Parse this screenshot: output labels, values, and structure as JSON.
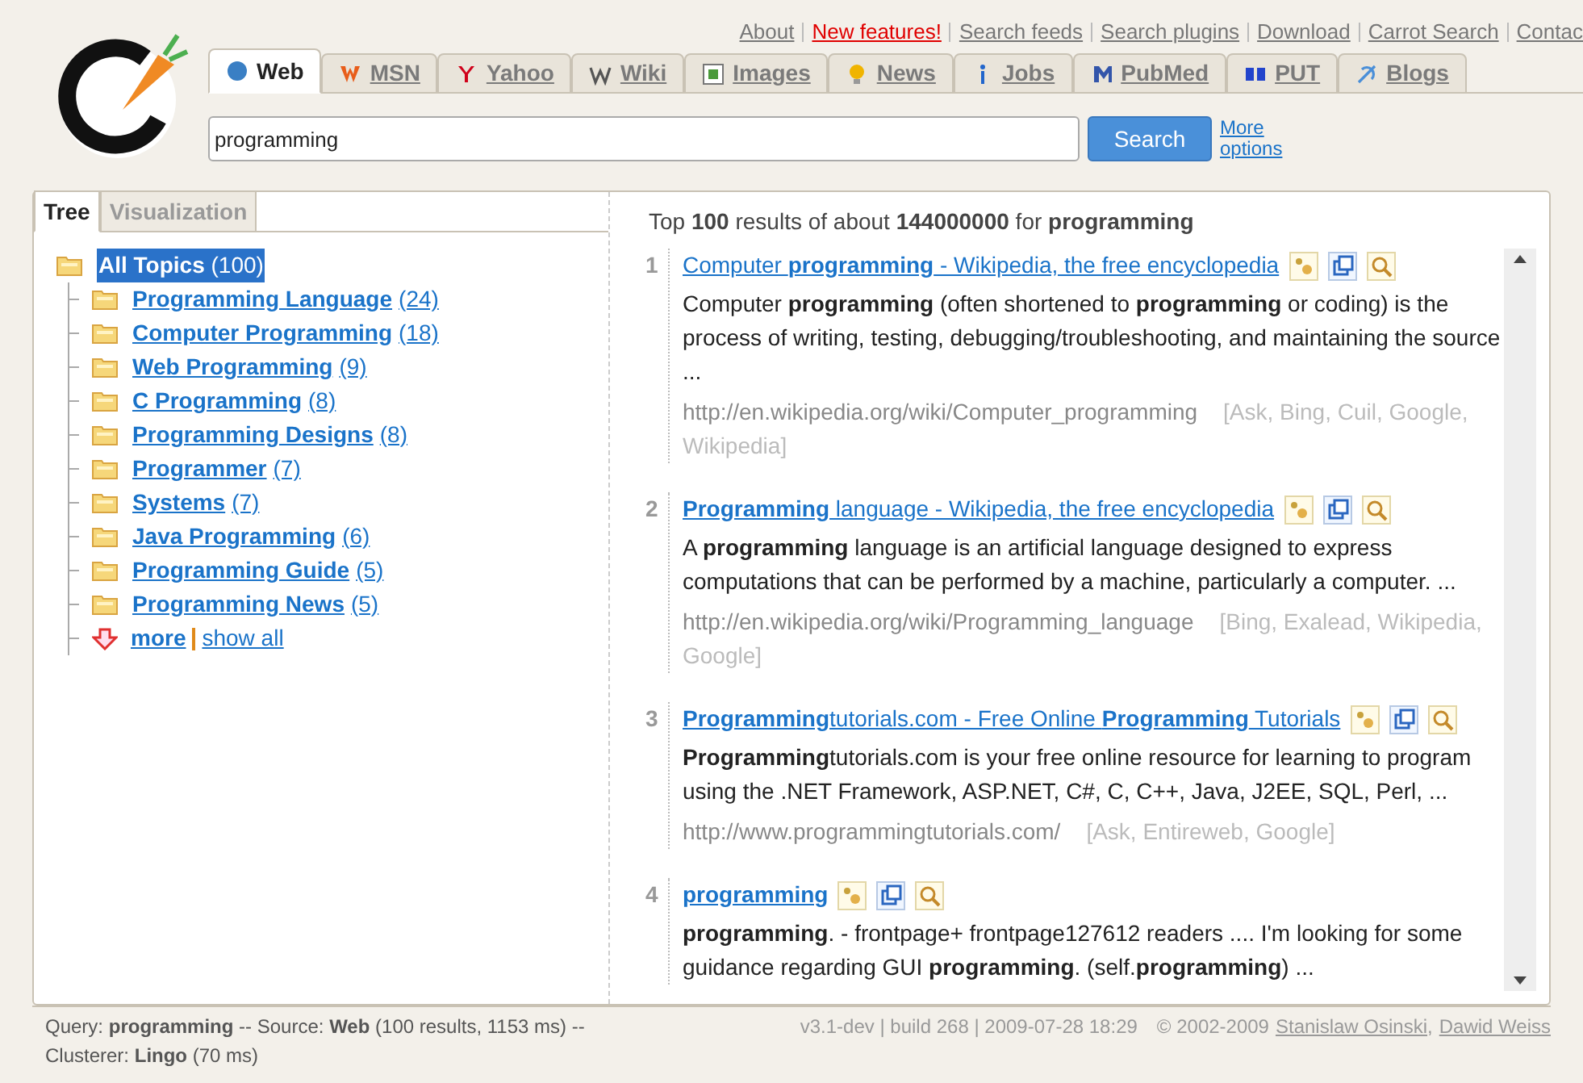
{
  "top_links": [
    {
      "label": "About",
      "highlight": false
    },
    {
      "label": "New features!",
      "highlight": true
    },
    {
      "label": "Search feeds",
      "highlight": false
    },
    {
      "label": "Search plugins",
      "highlight": false
    },
    {
      "label": "Download",
      "highlight": false
    },
    {
      "label": "Carrot Search",
      "highlight": false
    },
    {
      "label": "Contac",
      "highlight": false
    }
  ],
  "tabs": [
    {
      "label": "Web",
      "selected": true
    },
    {
      "label": "MSN",
      "selected": false
    },
    {
      "label": "Yahoo",
      "selected": false
    },
    {
      "label": "Wiki",
      "selected": false
    },
    {
      "label": "Images",
      "selected": false
    },
    {
      "label": "News",
      "selected": false
    },
    {
      "label": "Jobs",
      "selected": false
    },
    {
      "label": "PubMed",
      "selected": false
    },
    {
      "label": "PUT",
      "selected": false
    },
    {
      "label": "Blogs",
      "selected": false
    }
  ],
  "search": {
    "value": "programming",
    "button": "Search",
    "more_options": "More options"
  },
  "view_tabs": [
    {
      "label": "Tree",
      "selected": true
    },
    {
      "label": "Visualization",
      "selected": false
    }
  ],
  "tree": {
    "label": "All Topics",
    "count": "(100)",
    "selected": true,
    "children": [
      {
        "label": "Programming Language",
        "count": "(24)"
      },
      {
        "label": "Computer Programming",
        "count": "(18)"
      },
      {
        "label": "Web Programming",
        "count": "(9)"
      },
      {
        "label": "C Programming",
        "count": "(8)"
      },
      {
        "label": "Programming Designs",
        "count": "(8)"
      },
      {
        "label": "Programmer",
        "count": "(7)"
      },
      {
        "label": "Systems",
        "count": "(7)"
      },
      {
        "label": "Java Programming",
        "count": "(6)"
      },
      {
        "label": "Programming Guide",
        "count": "(5)"
      },
      {
        "label": "Programming News",
        "count": "(5)"
      }
    ],
    "more": "more",
    "show_all": "show all"
  },
  "summary": "Top **100** results of about **144000000** for **programming**",
  "results": [
    {
      "number": "1",
      "title": "Computer **programming** - Wikipedia, the free encyclopedia",
      "snippet": "Computer **programming** (often shortened to **programming** or coding) is the process of writing, testing, debugging/troubleshooting, and maintaining the source ...",
      "url": "http://en.wikipedia.org/wiki/Computer_programming",
      "sources": "[Ask, Bing, Cuil, Google, Wikipedia]"
    },
    {
      "number": "2",
      "title": "**Programming** language - Wikipedia, the free encyclopedia",
      "snippet": "A **programming** language is an artificial language designed to express computations that can be performed by a machine, particularly a computer. ...",
      "url": "http://en.wikipedia.org/wiki/Programming_language",
      "sources": "[Bing, Exalead, Wikipedia, Google]"
    },
    {
      "number": "3",
      "title": "**Programming**tutorials.com - Free Online **Programming** Tutorials",
      "snippet": "**Programming**tutorials.com is your free online resource for learning to program using the .NET Framework, ASP.NET, C#, C, C++, Java, J2EE, SQL, Perl, ...",
      "url": "http://www.programmingtutorials.com/",
      "sources": "[Ask, Entireweb, Google]"
    },
    {
      "number": "4",
      "title": "**programming**",
      "snippet": "**programming**. - frontpage+ frontpage127612 readers .... I'm looking for some guidance regarding GUI **programming**. (self.**programming**) ..."
    }
  ],
  "status": {
    "query": "Query: **programming** -- Source: **Web** (100 results, 1153 ms) --",
    "version": "v3.1-dev | build 268 | 2009-07-28 18:29",
    "copyright": "© 2002-2009",
    "authors": [
      "Stanislaw Osinski",
      "Dawid Weiss"
    ],
    "author_separator": ",",
    "clusterer": "Clusterer: **Lingo** (70 ms)"
  }
}
